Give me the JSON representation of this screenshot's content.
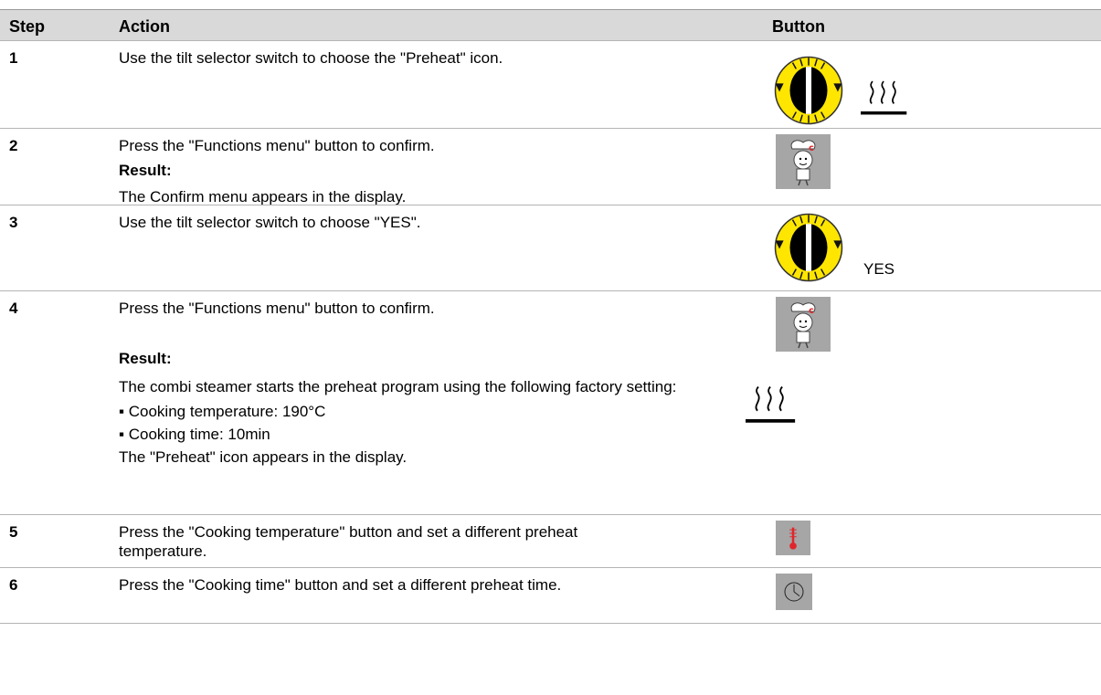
{
  "header": {
    "step": "Step",
    "action": "Action",
    "button": "Button"
  },
  "rows": [
    {
      "step": "1",
      "lines": [
        "Use the tilt selector switch to choose the \"Preheat\" icon."
      ]
    },
    {
      "step": "2",
      "lines": [
        "Press the \"Functions menu\" button to confirm.",
        "Result:",
        "The Confirm menu appears in the display."
      ]
    },
    {
      "step": "3",
      "lines": [
        "Use the tilt selector switch to choose \"YES\"."
      ],
      "button_text": "YES"
    },
    {
      "step": "4",
      "lines": [
        "Press the \"Functions menu\" button to confirm.",
        "Result:",
        "The combi steamer starts the preheat program using the following factory setting:",
        "▪ Cooking temperature: 190°C",
        "▪ Cooking time: 10min",
        "The \"Preheat\" icon appears in the display."
      ]
    },
    {
      "step": "5",
      "lines": [
        "Press the \"Cooking temperature\" button and set a different preheat temperature."
      ]
    },
    {
      "step": "6",
      "lines": [
        "Press the \"Cooking time\" button and set a different preheat time."
      ]
    }
  ],
  "icons": {
    "selector": "tilt-selector-switch-icon",
    "preheat": "preheat-icon",
    "functions": "functions-menu-chef-icon",
    "temperature": "thermometer-icon",
    "time": "clock-icon"
  },
  "colors": {
    "header_bg": "#d9d9d9",
    "selector_yellow": "#ffe600",
    "button_grey": "#a6a6a6",
    "thermo_red": "#e0262b"
  }
}
